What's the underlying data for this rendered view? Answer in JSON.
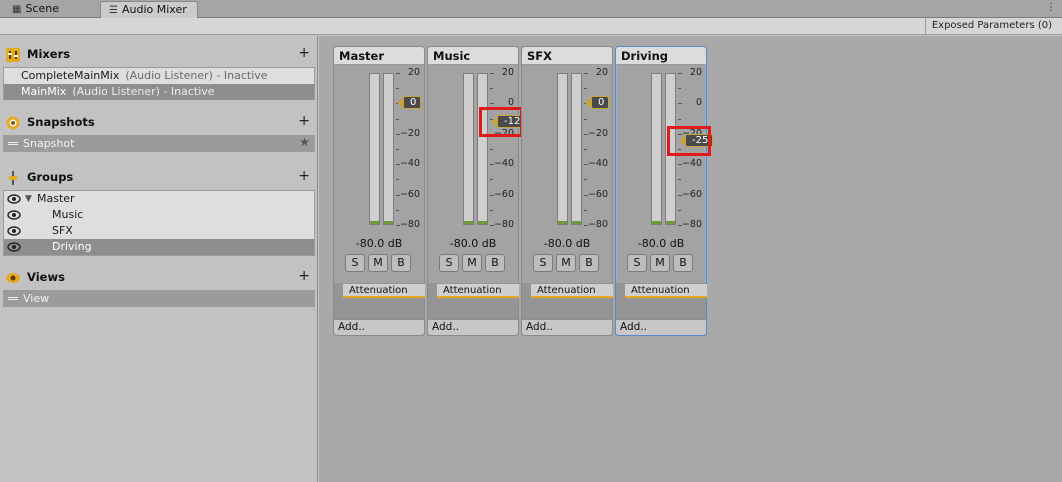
{
  "tabs": [
    {
      "label": "Scene",
      "icon": "grid-icon"
    },
    {
      "label": "Audio Mixer",
      "icon": "mixer-icon"
    }
  ],
  "toolbar": {
    "exposed_params": "Exposed Parameters (0)"
  },
  "sections": {
    "mixers": {
      "title": "Mixers",
      "items": [
        {
          "name": "CompleteMainMix",
          "status": "(Audio Listener) - Inactive"
        },
        {
          "name": "MainMix",
          "status": "(Audio Listener) - Inactive"
        }
      ]
    },
    "snapshots": {
      "title": "Snapshots",
      "items": [
        "Snapshot"
      ]
    },
    "groups": {
      "title": "Groups",
      "items": [
        "Master",
        "Music",
        "SFX",
        "Driving"
      ]
    },
    "views": {
      "title": "Views",
      "items": [
        "View"
      ]
    }
  },
  "scale_labels": [
    "20",
    "0",
    "−20",
    "−40",
    "−60",
    "−80"
  ],
  "strips": [
    {
      "name": "Master",
      "level_db": "-80.0 dB",
      "attenuation": "0",
      "effect": "Attenuation",
      "add": "Add..",
      "solo": "S",
      "mute": "M",
      "bypass": "B"
    },
    {
      "name": "Music",
      "level_db": "-80.0 dB",
      "attenuation": "-12",
      "effect": "Attenuation",
      "add": "Add..",
      "solo": "S",
      "mute": "M",
      "bypass": "B"
    },
    {
      "name": "SFX",
      "level_db": "-80.0 dB",
      "attenuation": "0",
      "effect": "Attenuation",
      "add": "Add..",
      "solo": "S",
      "mute": "M",
      "bypass": "B"
    },
    {
      "name": "Driving",
      "level_db": "-80.0 dB",
      "attenuation": "-25",
      "effect": "Attenuation",
      "add": "Add..",
      "solo": "S",
      "mute": "M",
      "bypass": "B"
    }
  ],
  "colors": {
    "accent": "#e3a921",
    "selection": "#8e8e8e",
    "highlight_box": "#e01a1a",
    "active_strip": "#5a87c6"
  }
}
